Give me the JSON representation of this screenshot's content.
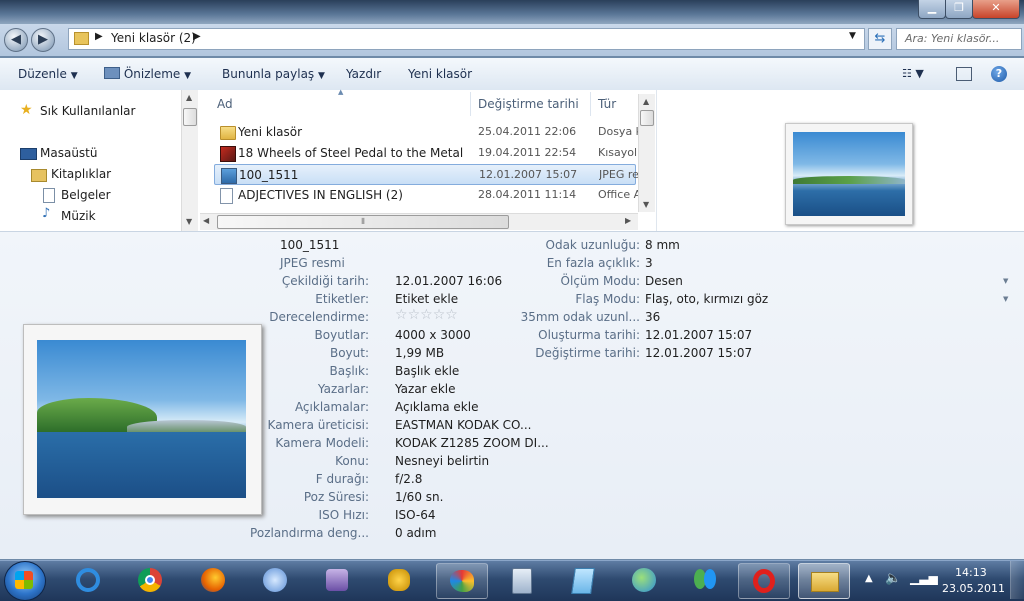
{
  "nav": {
    "breadcrumb": [
      "Yeni klasör (2)"
    ],
    "search_placeholder": "Ara: Yeni klasör..."
  },
  "toolbar": {
    "organize": "Düzenle",
    "preview": "Önizleme",
    "share": "Bununla paylaş",
    "print": "Yazdır",
    "new_folder": "Yeni klasör"
  },
  "sidebar": {
    "items": [
      {
        "label": "Sık Kullanılanlar",
        "icon": "star-icon"
      },
      {
        "label": "Masaüstü",
        "icon": "desktop-icon"
      },
      {
        "label": "Kitaplıklar",
        "icon": "libraries-icon"
      },
      {
        "label": "Belgeler",
        "icon": "documents-icon"
      },
      {
        "label": "Müzik",
        "icon": "music-icon"
      }
    ]
  },
  "filelist": {
    "columns": [
      "Ad",
      "Değiştirme tarihi",
      "Tür"
    ],
    "rows": [
      {
        "name": "Yeni klasör",
        "date": "25.04.2011 22:06",
        "type": "Dosya k",
        "icon": "folder-icon"
      },
      {
        "name": "18 Wheels of Steel Pedal to the Metal",
        "date": "19.04.2011 22:54",
        "type": "Kısayol",
        "icon": "game-shortcut-icon"
      },
      {
        "name": "100_1511",
        "date": "12.01.2007 15:07",
        "type": "JPEG re",
        "icon": "image-file-icon"
      },
      {
        "name": "ADJECTIVES IN ENGLISH (2)",
        "date": "28.04.2011 11:14",
        "type": "Office A",
        "icon": "document-icon"
      }
    ]
  },
  "details": {
    "title": "100_1511",
    "subtitle": "JPEG resmi",
    "left": [
      {
        "label": "Çekildiği tarih:",
        "value": "12.01.2007 16:06"
      },
      {
        "label": "Etiketler:",
        "value": "Etiket ekle"
      },
      {
        "label": "Derecelendirme:",
        "value": ""
      },
      {
        "label": "Boyutlar:",
        "value": "4000 x 3000"
      },
      {
        "label": "Boyut:",
        "value": "1,99 MB"
      },
      {
        "label": "Başlık:",
        "value": "Başlık ekle"
      },
      {
        "label": "Yazarlar:",
        "value": "Yazar ekle"
      },
      {
        "label": "Açıklamalar:",
        "value": "Açıklama ekle"
      },
      {
        "label": "Kamera üreticisi:",
        "value": "EASTMAN KODAK CO..."
      },
      {
        "label": "Kamera Modeli:",
        "value": "KODAK Z1285 ZOOM DI..."
      },
      {
        "label": "Konu:",
        "value": "Nesneyi belirtin"
      },
      {
        "label": "F durağı:",
        "value": "f/2.8"
      },
      {
        "label": "Poz Süresi:",
        "value": "1/60 sn."
      },
      {
        "label": "ISO Hızı:",
        "value": "ISO-64"
      },
      {
        "label": "Pozlandırma deng...",
        "value": "0 adım"
      }
    ],
    "right": [
      {
        "label": "Odak uzunluğu:",
        "value": "8 mm"
      },
      {
        "label": "En fazla açıklık:",
        "value": "3"
      },
      {
        "label": "Ölçüm Modu:",
        "value": "Desen"
      },
      {
        "label": "Flaş Modu:",
        "value": "Flaş, oto, kırmızı göz"
      },
      {
        "label": "35mm odak uzunl...",
        "value": "36"
      },
      {
        "label": "Oluşturma tarihi:",
        "value": "12.01.2007 15:07"
      },
      {
        "label": "Değiştirme tarihi:",
        "value": "12.01.2007 15:07"
      }
    ],
    "rating": 0
  },
  "taskbar": {
    "time": "14:13",
    "date": "23.05.2011"
  }
}
